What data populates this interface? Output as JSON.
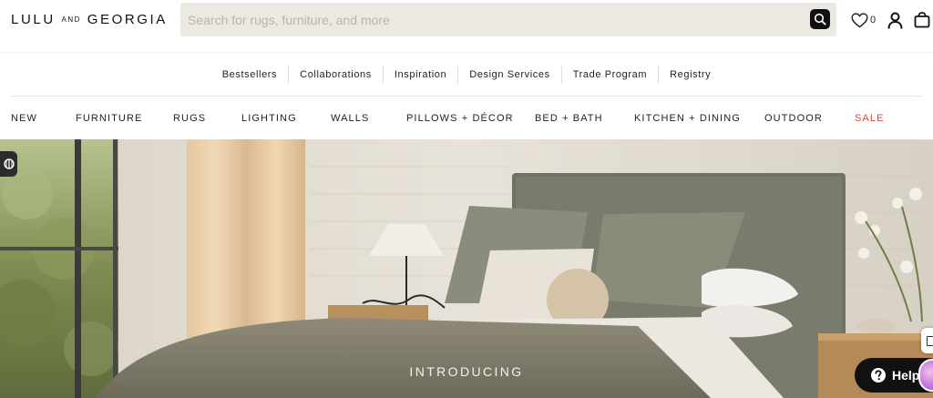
{
  "header": {
    "logo_left": "LULU",
    "logo_and": "AND",
    "logo_right": "GEORGIA",
    "search_placeholder": "Search for rugs, furniture, and more",
    "search_value": "",
    "wishlist_count": "0",
    "icons": [
      "search-icon",
      "heart-icon",
      "user-icon",
      "shopping-bag-icon"
    ]
  },
  "subnav": {
    "items": [
      "Bestsellers",
      "Collaborations",
      "Inspiration",
      "Design Services",
      "Trade Program",
      "Registry"
    ]
  },
  "mainnav": {
    "items": [
      "NEW",
      "FURNITURE",
      "RUGS",
      "LIGHTING",
      "WALLS",
      "PILLOWS + DÉCOR",
      "BED + BATH",
      "KITCHEN + DINING",
      "OUTDOOR",
      "SALE"
    ],
    "sale_color": "#d8453a"
  },
  "hero": {
    "text": "INTRODUCING"
  },
  "widgets": {
    "help_label": "Help",
    "icons": [
      "accessibility-icon",
      "question-icon",
      "chat-icon"
    ]
  },
  "colors": {
    "search_bg": "#ece8e2",
    "sale": "#d8453a",
    "help_bg": "#111111"
  }
}
